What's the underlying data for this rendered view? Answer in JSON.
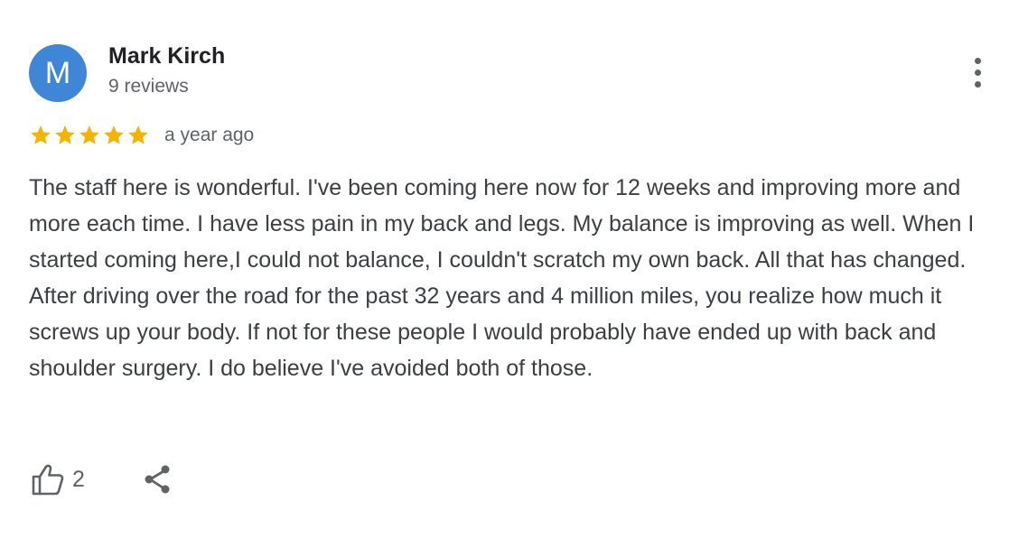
{
  "review": {
    "author": {
      "initial": "M",
      "name": "Mark Kirch",
      "meta": "9 reviews",
      "avatar_color": "#3f86d6"
    },
    "rating": {
      "stars": 5,
      "max": 5,
      "star_color": "#f4b400"
    },
    "time": "a year ago",
    "text": "The staff here is wonderful. I've been coming here now for 12 weeks and improving more and more each time. I have less pain in my back and legs. My balance is improving as well. When I started coming here,I could not balance, I couldn't scratch my own back. All that has changed. After driving over the road for the past 32 years and 4 million miles, you realize how much it screws up your body. If not for these people I would probably have ended up with back and shoulder surgery. I do believe I've avoided both of those.",
    "actions": {
      "like_icon": "thumb-up-outline-icon",
      "like_count": "2",
      "share_icon": "share-icon",
      "menu_icon": "more-vert-icon"
    }
  }
}
